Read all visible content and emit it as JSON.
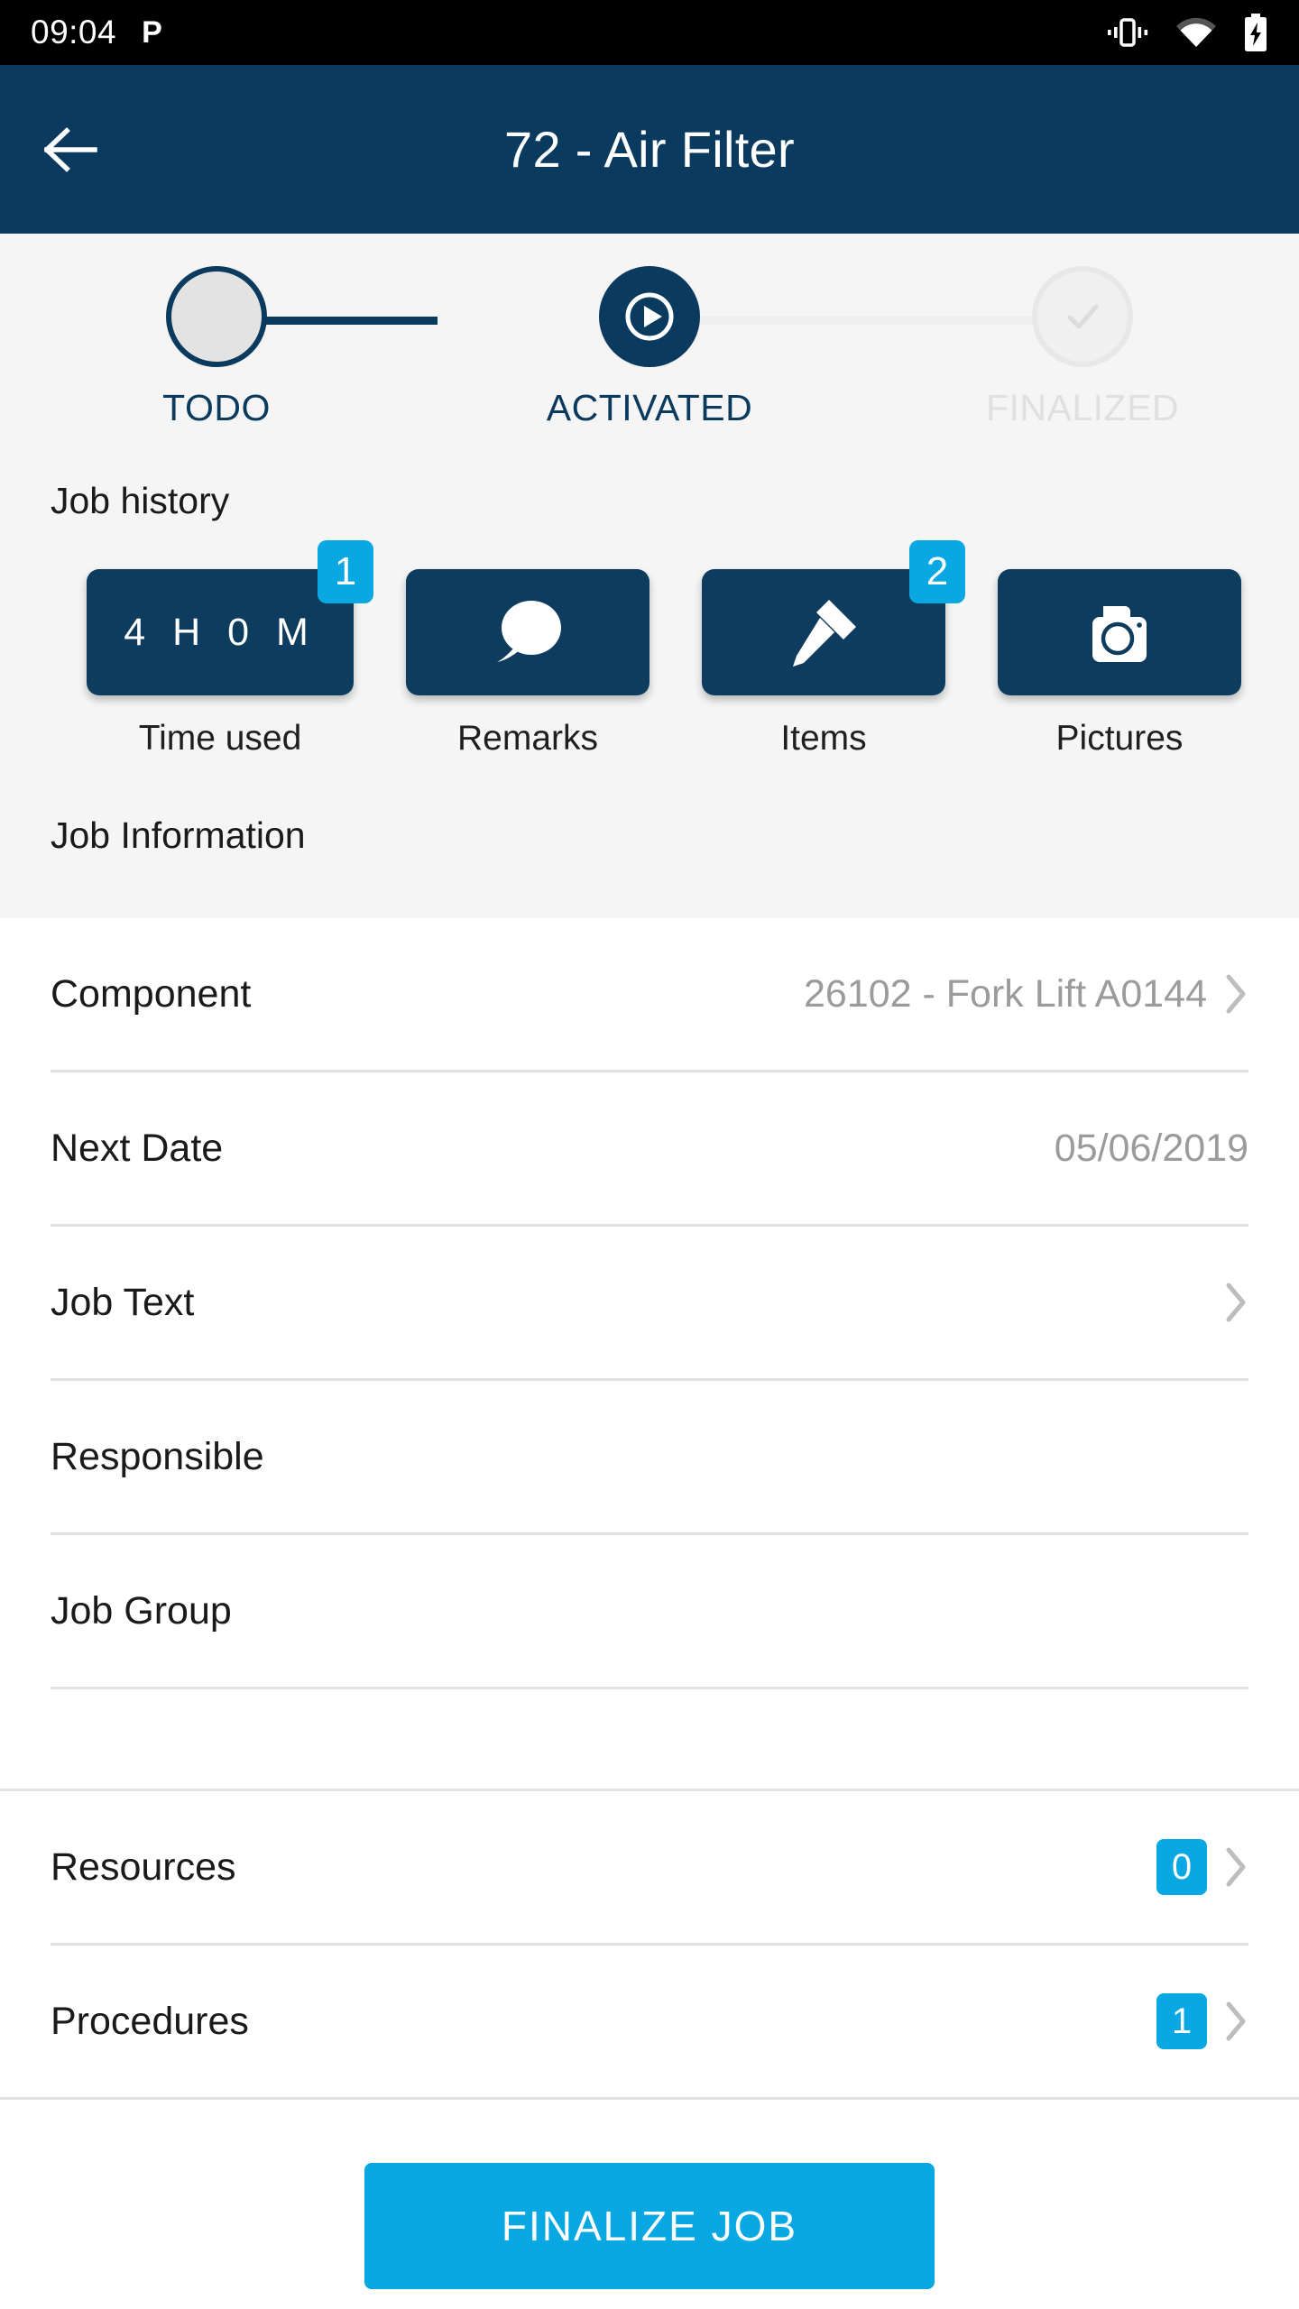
{
  "statusbar": {
    "time": "09:04",
    "app_indicator": "P",
    "icons": [
      "vibrate-icon",
      "wifi-icon",
      "battery-charging-icon"
    ]
  },
  "appbar": {
    "back_icon": "arrow-left-icon",
    "title": "72 - Air Filter"
  },
  "stepper": {
    "steps": [
      {
        "label": "TODO",
        "state": "pending",
        "icon": "empty-circle-icon"
      },
      {
        "label": "ACTIVATED",
        "state": "active",
        "icon": "play-icon"
      },
      {
        "label": "FINALIZED",
        "state": "disabled",
        "icon": "check-icon"
      }
    ]
  },
  "job_history": {
    "title": "Job history",
    "tiles": [
      {
        "label": "Time used",
        "value": "4 H 0 M",
        "badge": "1",
        "icon": "time-text"
      },
      {
        "label": "Remarks",
        "value": "",
        "badge": "",
        "icon": "speech-bubble-icon"
      },
      {
        "label": "Items",
        "value": "",
        "badge": "2",
        "icon": "hammer-icon"
      },
      {
        "label": "Pictures",
        "value": "",
        "badge": "",
        "icon": "camera-icon"
      }
    ]
  },
  "job_information": {
    "title": "Job Information",
    "rows": [
      {
        "label": "Component",
        "value": "26102 - Fork Lift A0144",
        "chevron": true,
        "badge": ""
      },
      {
        "label": "Next Date",
        "value": "05/06/2019",
        "chevron": false,
        "badge": ""
      },
      {
        "label": "Job Text",
        "value": "",
        "chevron": true,
        "badge": ""
      },
      {
        "label": "Responsible",
        "value": "",
        "chevron": false,
        "badge": ""
      },
      {
        "label": "Job Group",
        "value": "",
        "chevron": false,
        "badge": ""
      }
    ]
  },
  "links": {
    "rows": [
      {
        "label": "Resources",
        "badge": "0",
        "chevron": true
      },
      {
        "label": "Procedures",
        "badge": "1",
        "chevron": true
      }
    ]
  },
  "bottom": {
    "finalize_label": "FINALIZE JOB"
  },
  "colors": {
    "brand_dark": "#0a3a5e",
    "accent_cyan": "#0aa8e2",
    "tile_dark": "#0d3c5f",
    "muted_text": "#9b9b9b",
    "grey_bg": "#f5f5f5"
  }
}
